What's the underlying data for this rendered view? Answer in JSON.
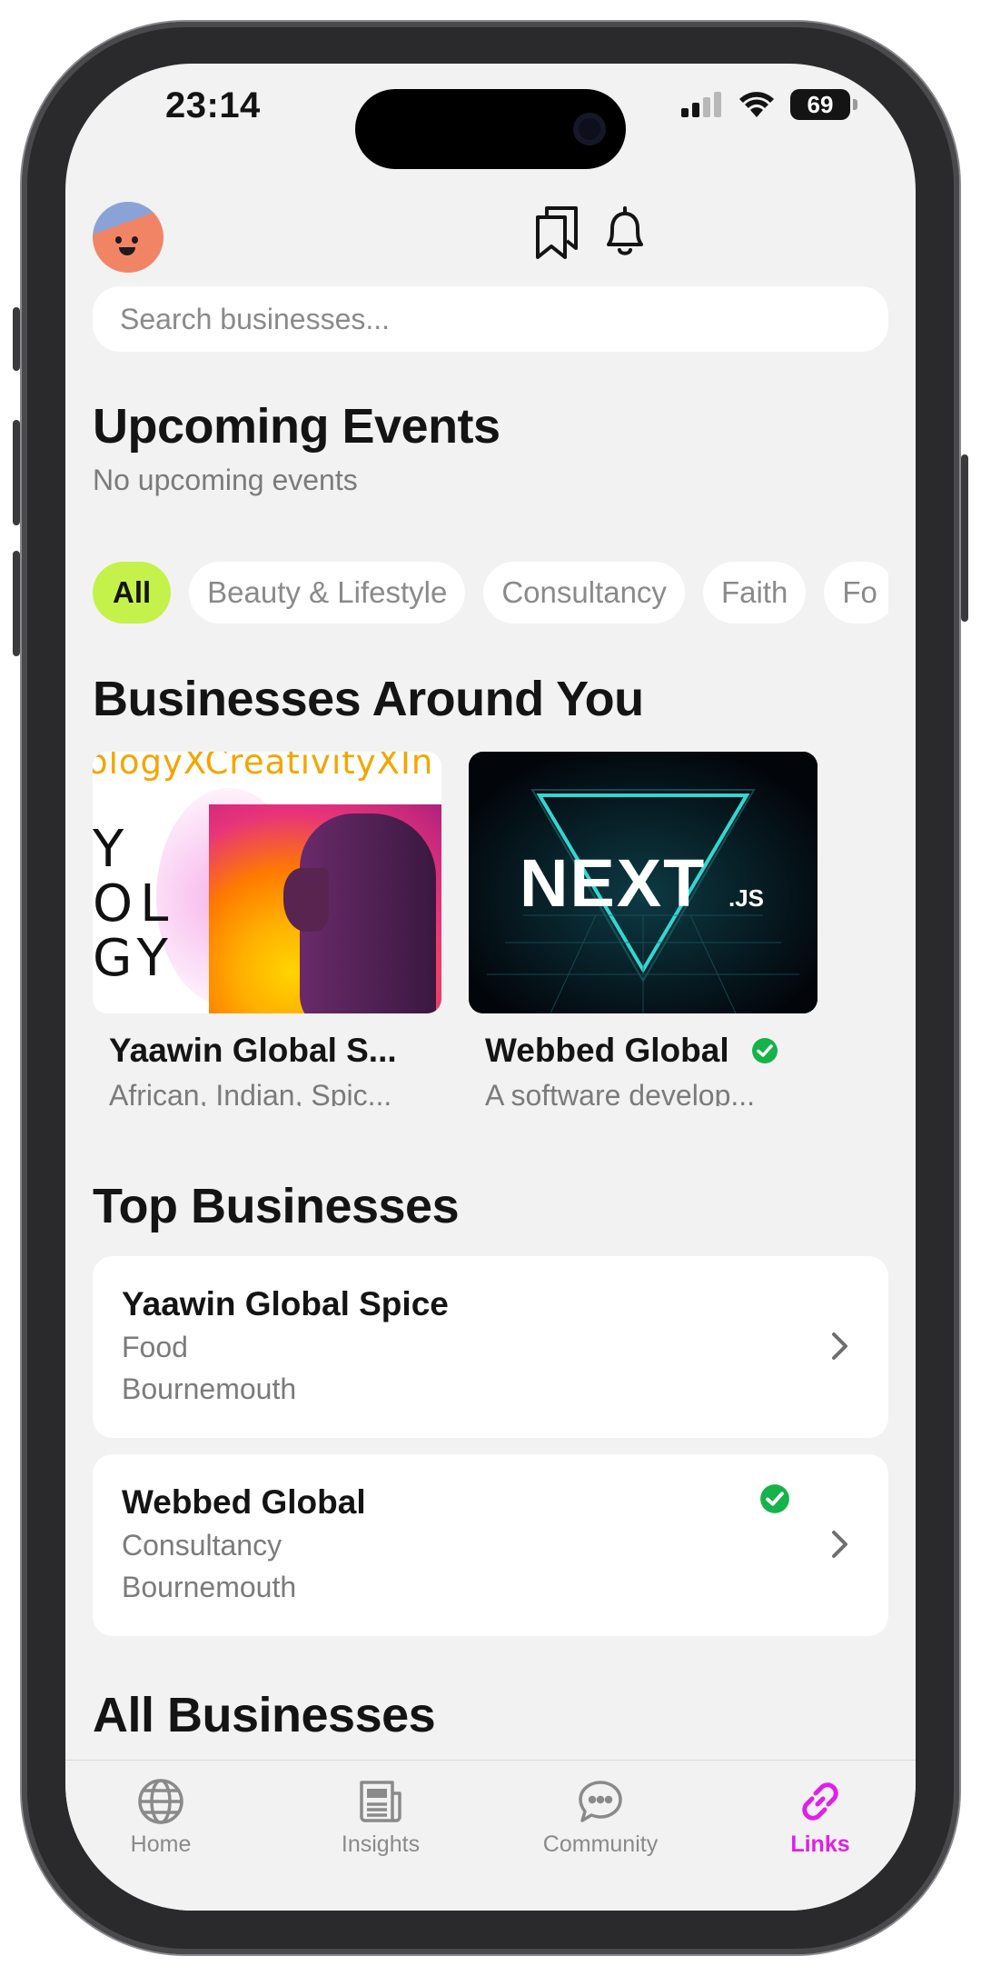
{
  "status_bar": {
    "time": "23:14",
    "battery": "69"
  },
  "header": {
    "avatar": "avatar-face",
    "icons": [
      "bookmarks-icon",
      "bell-icon"
    ]
  },
  "search": {
    "placeholder": "Search businesses..."
  },
  "events": {
    "title": "Upcoming Events",
    "empty_text": "No upcoming events"
  },
  "categories": {
    "items": [
      "All",
      "Beauty & Lifestyle",
      "Consultancy",
      "Faith",
      "Fo"
    ],
    "selected": "All"
  },
  "around_you": {
    "title": "Businesses Around You",
    "cards": [
      {
        "name": "Yaawin Global S...",
        "description": "African, Indian, Spic...",
        "image_text": {
          "line": "ologyXCreativityXIn",
          "letters": [
            "Y",
            "OL",
            "GY"
          ]
        }
      },
      {
        "name": "Webbed Global",
        "description": "A software develop...",
        "verified": true,
        "image_text": {
          "logo": "NEXT",
          "suffix": ".JS"
        }
      }
    ]
  },
  "top_businesses": {
    "title": "Top Businesses",
    "items": [
      {
        "name": "Yaawin Global Spice",
        "category": "Food",
        "location": "Bournemouth",
        "verified": false
      },
      {
        "name": "Webbed Global",
        "category": "Consultancy",
        "location": "Bournemouth",
        "verified": true
      }
    ]
  },
  "all_businesses": {
    "title": "All Businesses"
  },
  "tabbar": {
    "tabs": [
      {
        "label": "Home",
        "icon": "globe-icon"
      },
      {
        "label": "Insights",
        "icon": "newspaper-icon"
      },
      {
        "label": "Community",
        "icon": "chat-bubble-icon"
      },
      {
        "label": "Links",
        "icon": "link-icon"
      }
    ],
    "active": "Links"
  },
  "colors": {
    "accent_chip": "#c5f24a",
    "active_tab": "#e020e8",
    "verified": "#16b24a",
    "background": "#f2f2f2"
  }
}
